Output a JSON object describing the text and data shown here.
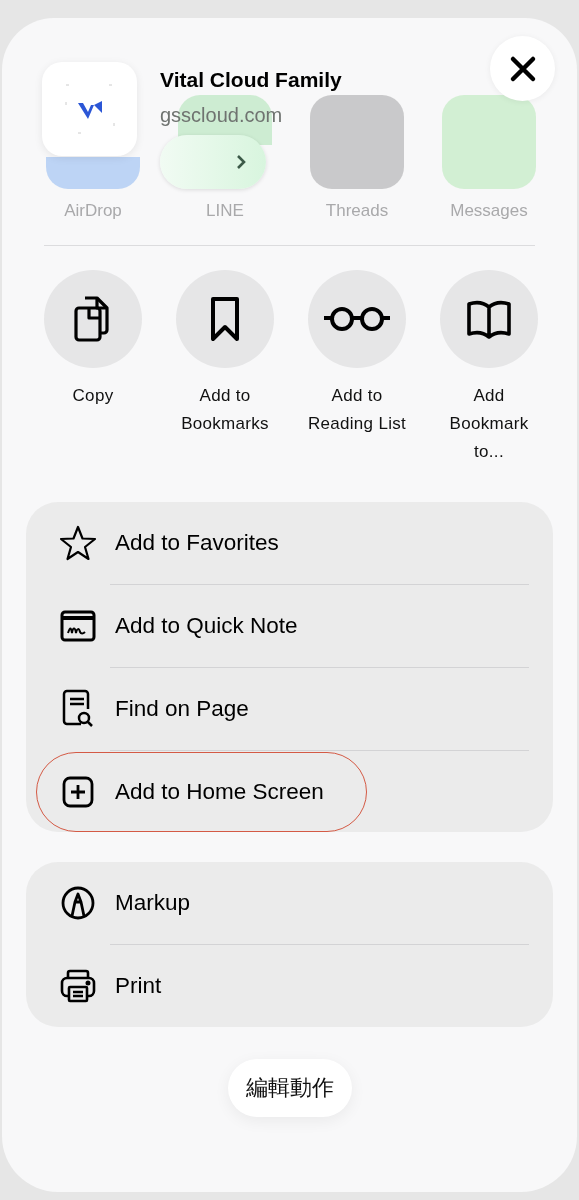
{
  "header": {
    "title": "Vital Cloud Family",
    "domain": "gsscloud.com"
  },
  "share_targets": [
    {
      "label": "AirDrop",
      "kind": "airdrop"
    },
    {
      "label": "LINE",
      "kind": "line"
    },
    {
      "label": "Threads",
      "kind": "threads"
    },
    {
      "label": "Messages",
      "kind": "messages"
    }
  ],
  "actions": [
    {
      "label": "Copy",
      "kind": "copy"
    },
    {
      "label": "Add to\nBookmarks",
      "kind": "bookmark"
    },
    {
      "label": "Add to\nReading List",
      "kind": "glasses"
    },
    {
      "label": "Add\nBookmark\nto...",
      "kind": "book"
    }
  ],
  "menu_groups": [
    [
      {
        "label": "Add to Favorites",
        "kind": "star",
        "highlighted": false
      },
      {
        "label": "Add to Quick Note",
        "kind": "note",
        "highlighted": false
      },
      {
        "label": "Find on Page",
        "kind": "find",
        "highlighted": false
      },
      {
        "label": "Add to Home Screen",
        "kind": "add",
        "highlighted": true
      }
    ],
    [
      {
        "label": "Markup",
        "kind": "markup",
        "highlighted": false
      },
      {
        "label": "Print",
        "kind": "print",
        "highlighted": false
      }
    ]
  ],
  "edit_button": "編輯動作"
}
